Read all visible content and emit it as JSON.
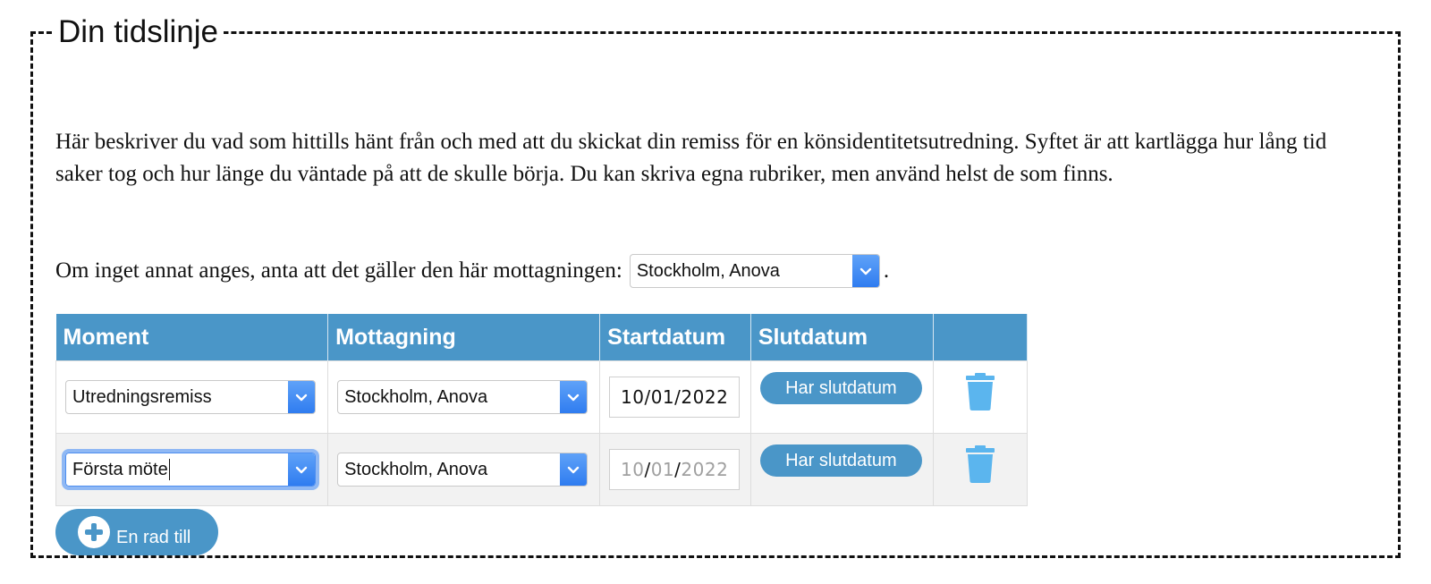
{
  "section": {
    "title": "Din tidslinje",
    "intro": "Här beskriver du vad som hittills hänt från och med att du skickat din remiss för en könsidentitetsutredning. Syftet är att kartlägga hur lång tid saker tog och hur länge du väntade på att de skulle börja. Du kan skriva egna rubriker, men använd helst de som finns.",
    "default_prefix": "Om inget annat anges, anta att det gäller den här mottagningen:",
    "default_clinic": "Stockholm, Anova",
    "default_suffix": "."
  },
  "table": {
    "headers": [
      "Moment",
      "Mottagning",
      "Startdatum",
      "Slutdatum",
      ""
    ],
    "rows": [
      {
        "moment": "Utredningsremiss",
        "clinic": "Stockholm, Anova",
        "start_day": "10",
        "start_month": "01",
        "start_year": "2022",
        "start_is_placeholder": false,
        "end_button": "Har slutdatum"
      },
      {
        "moment": "Första möte",
        "clinic": "Stockholm, Anova",
        "start_day": "10",
        "start_month": "01",
        "start_year": "2022",
        "start_is_placeholder": true,
        "end_button": "Har slutdatum"
      }
    ]
  },
  "add_row_label": "En rad till",
  "icons": {
    "select_arrow": "chevron-down-icon",
    "delete": "trash-icon",
    "add": "plus-circle-icon"
  },
  "colors": {
    "accent": "#4a96c8",
    "select_arrow": "#3f87f3",
    "trash": "#5bb5ee",
    "focus": "#8fb8f4"
  }
}
